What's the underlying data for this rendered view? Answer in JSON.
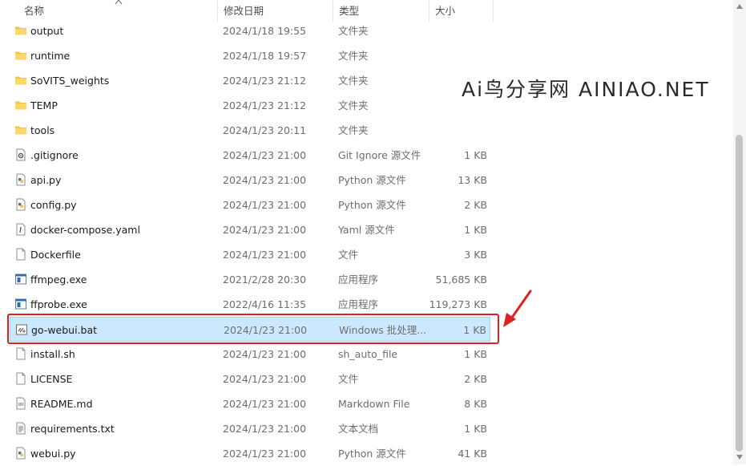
{
  "columns": {
    "name": "名称",
    "date": "修改日期",
    "type": "类型",
    "size": "大小"
  },
  "watermark": "Ai鸟分享网   AINIAO.NET",
  "colors": {
    "selection": "#cce8ff",
    "highlight": "#e02020",
    "folder": "#f5c542"
  },
  "files": [
    {
      "name": "output",
      "date": "2024/1/18 19:55",
      "type": "文件夹",
      "size": "",
      "icon": "folder-icon"
    },
    {
      "name": "runtime",
      "date": "2024/1/18 19:57",
      "type": "文件夹",
      "size": "",
      "icon": "folder-icon"
    },
    {
      "name": "SoVITS_weights",
      "date": "2024/1/23 21:12",
      "type": "文件夹",
      "size": "",
      "icon": "folder-icon"
    },
    {
      "name": "TEMP",
      "date": "2024/1/23 21:12",
      "type": "文件夹",
      "size": "",
      "icon": "folder-icon"
    },
    {
      "name": "tools",
      "date": "2024/1/23 20:11",
      "type": "文件夹",
      "size": "",
      "icon": "folder-icon"
    },
    {
      "name": ".gitignore",
      "date": "2024/1/23 21:00",
      "type": "Git Ignore 源文件",
      "size": "1 KB",
      "icon": "gear-file-icon"
    },
    {
      "name": "api.py",
      "date": "2024/1/23 21:00",
      "type": "Python 源文件",
      "size": "13 KB",
      "icon": "python-file-icon"
    },
    {
      "name": "config.py",
      "date": "2024/1/23 21:00",
      "type": "Python 源文件",
      "size": "2 KB",
      "icon": "python-file-icon"
    },
    {
      "name": "docker-compose.yaml",
      "date": "2024/1/23 21:00",
      "type": "Yaml 源文件",
      "size": "1 KB",
      "icon": "yaml-file-icon"
    },
    {
      "name": "Dockerfile",
      "date": "2024/1/23 21:00",
      "type": "文件",
      "size": "3 KB",
      "icon": "blank-file-icon"
    },
    {
      "name": "ffmpeg.exe",
      "date": "2021/2/28 20:30",
      "type": "应用程序",
      "size": "51,685 KB",
      "icon": "exe-icon"
    },
    {
      "name": "ffprobe.exe",
      "date": "2022/4/16 11:35",
      "type": "应用程序",
      "size": "119,273 KB",
      "icon": "exe-icon"
    },
    {
      "name": "go-webui.bat",
      "date": "2024/1/23 21:00",
      "type": "Windows 批处理...",
      "size": "1 KB",
      "icon": "batch-file-icon",
      "selected": true
    },
    {
      "name": "install.sh",
      "date": "2024/1/23 21:00",
      "type": "sh_auto_file",
      "size": "1 KB",
      "icon": "blank-file-icon"
    },
    {
      "name": "LICENSE",
      "date": "2024/1/23 21:00",
      "type": "文件",
      "size": "2 KB",
      "icon": "blank-file-icon"
    },
    {
      "name": "README.md",
      "date": "2024/1/23 21:00",
      "type": "Markdown File",
      "size": "8 KB",
      "icon": "markdown-file-icon"
    },
    {
      "name": "requirements.txt",
      "date": "2024/1/23 21:00",
      "type": "文本文档",
      "size": "1 KB",
      "icon": "text-file-icon"
    },
    {
      "name": "webui.py",
      "date": "2024/1/23 21:00",
      "type": "Python 源文件",
      "size": "41 KB",
      "icon": "python-file-icon"
    }
  ]
}
